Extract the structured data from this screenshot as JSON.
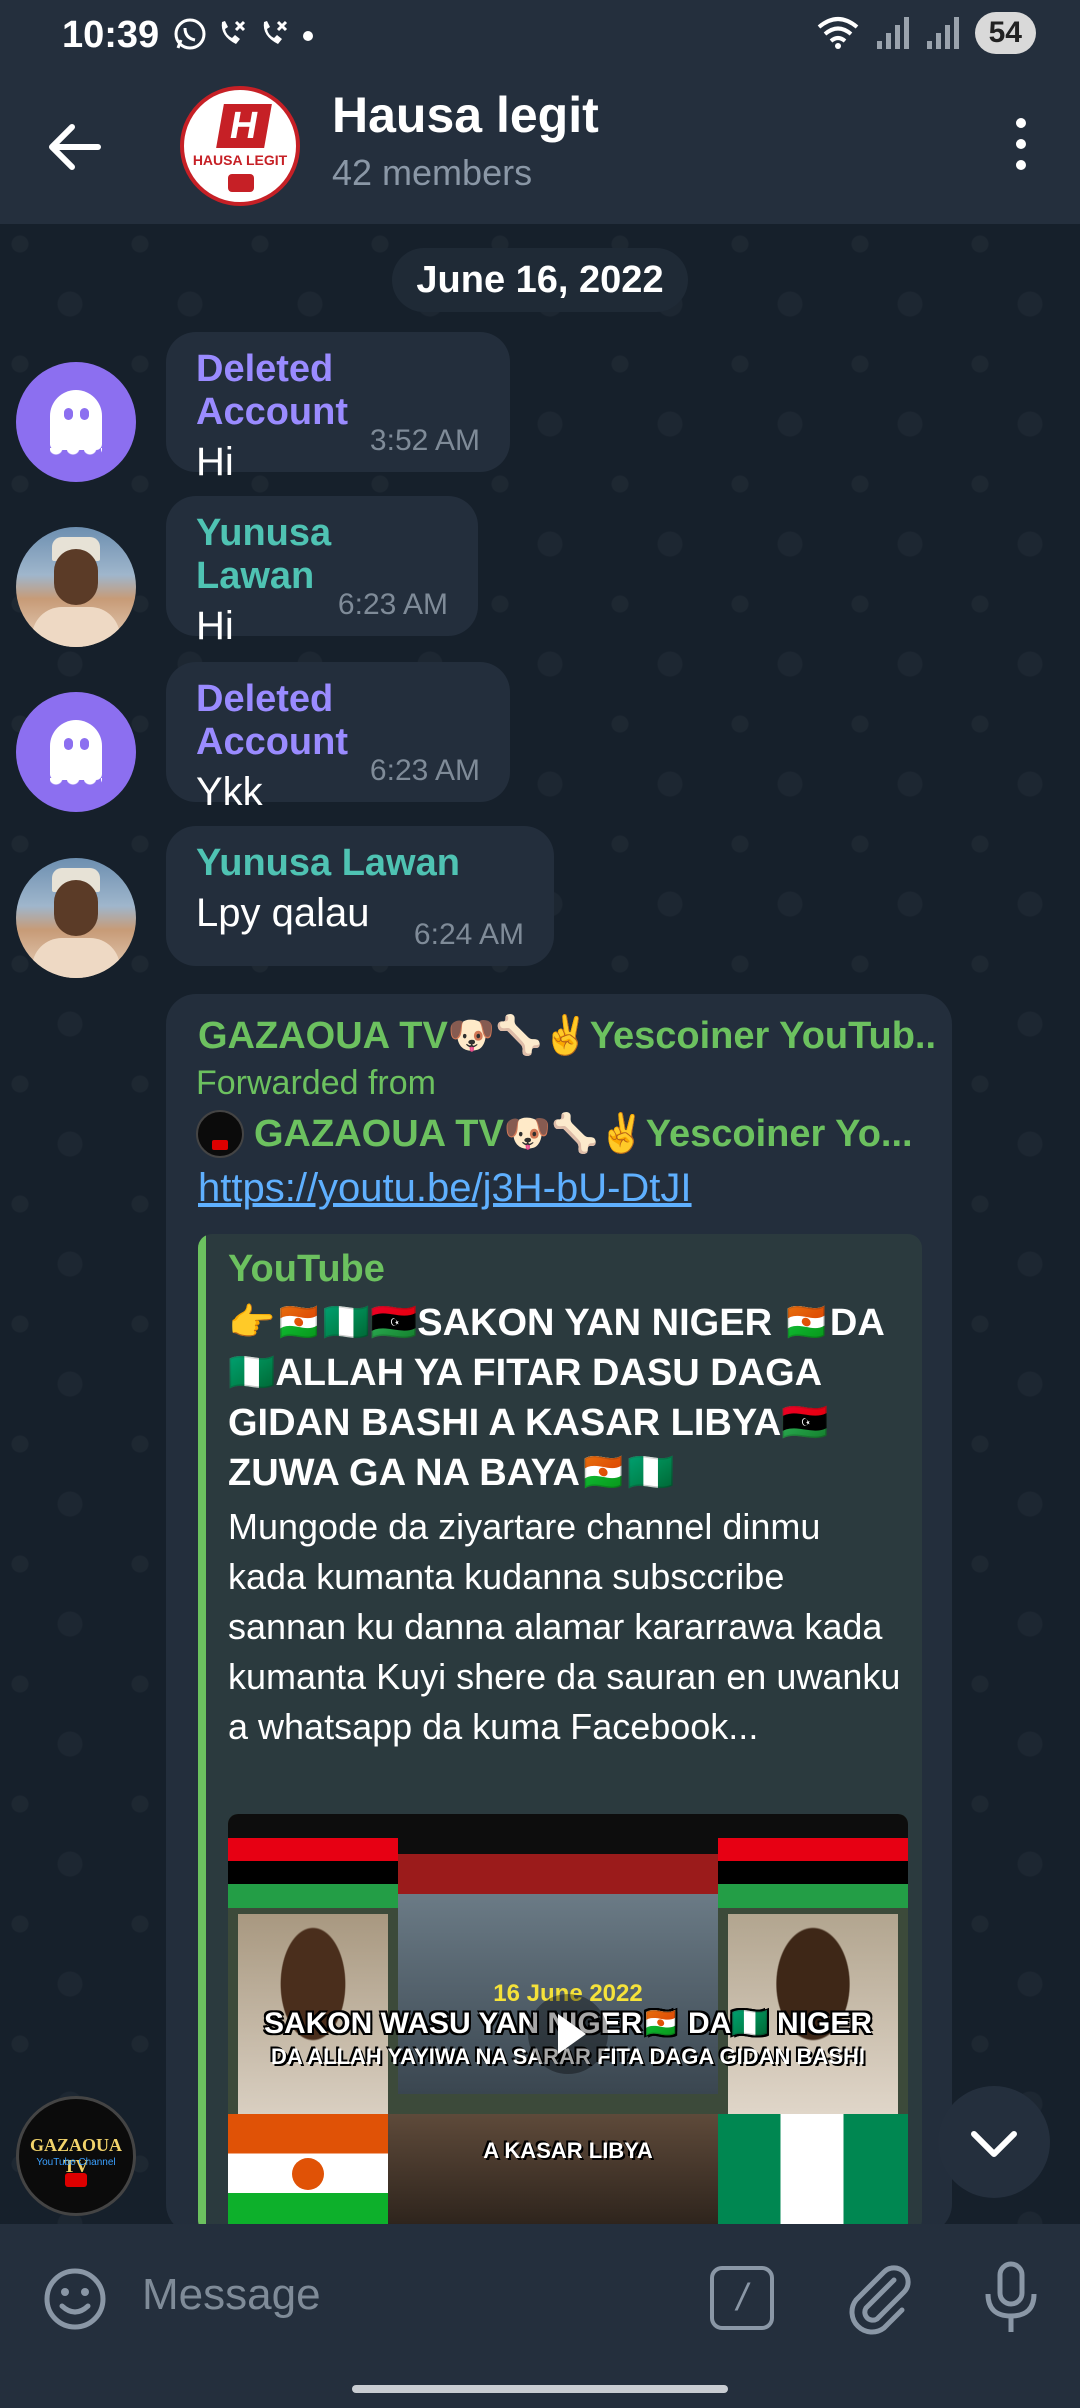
{
  "status_bar": {
    "time": "10:39",
    "left_icons": [
      "whatsapp-icon",
      "missed-call-icon",
      "missed-call-icon",
      "dot-icon"
    ],
    "battery": "54"
  },
  "header": {
    "title": "Hausa legit",
    "subtitle": "42 members",
    "avatar_text": "HAUSA LEGIT",
    "avatar_letter": "H"
  },
  "chat": {
    "date_label": "June 16, 2022",
    "messages": [
      {
        "sender": "Deleted Account",
        "text": "Hi",
        "time": "3:52 AM"
      },
      {
        "sender": "Yunusa Lawan",
        "text": "Hi",
        "time": "6:23 AM"
      },
      {
        "sender": "Deleted Account",
        "text": "Ykk",
        "time": "6:23 AM"
      },
      {
        "sender": "Yunusa Lawan",
        "text": "Lpy qalau",
        "time": "6:24 AM"
      }
    ],
    "forwarded": {
      "channel": "GAZAOUA TV🐶🦴✌️Yescoiner YouTub...",
      "label": "Forwarded from",
      "from_name": "GAZAOUA TV🐶🦴✌️Yescoiner Yo...",
      "link": "https://youtu.be/j3H-bU-DtJI",
      "avatar_title": "GAZAOUA TV",
      "avatar_subtitle": "YouTube Channel",
      "preview": {
        "site": "YouTube",
        "title": "👉🇳🇪🇳🇬🇱🇾SAKON YAN NIGER 🇳🇪DA🇳🇬ALLAH YA FITAR DASU DAGA GIDAN BASHI A KASAR LIBYA🇱🇾ZUWA GA NA BAYA🇳🇪🇳🇬",
        "description": "Mungode da ziyartare channel dinmu kada kumanta kudanna subsccribe sannan ku danna alamar kararrawa kada kumanta Kuyi shere da sauran en uwanku a whatsapp da kuma Facebook...",
        "thumb_date": "16 June 2022",
        "thumb_caption_1": "SAKON WASU YAN NIGER🇳🇪 DA🇳🇬 NIGER",
        "thumb_caption_2": "DA ALLAH YAYIWA NA SARAR FITA DAGA GIDAN BASHI",
        "thumb_caption_3": "A KASAR LIBYA"
      }
    }
  },
  "input": {
    "placeholder": "Message",
    "command_symbol": "/"
  },
  "colors": {
    "header_bg": "#242f3d",
    "chat_bg": "#16202b",
    "bubble_bg": "#232e3c",
    "deleted_name": "#9a8bff",
    "user_name": "#4fc3b3",
    "channel_name": "#6cc15f",
    "link": "#5fb0ff"
  }
}
